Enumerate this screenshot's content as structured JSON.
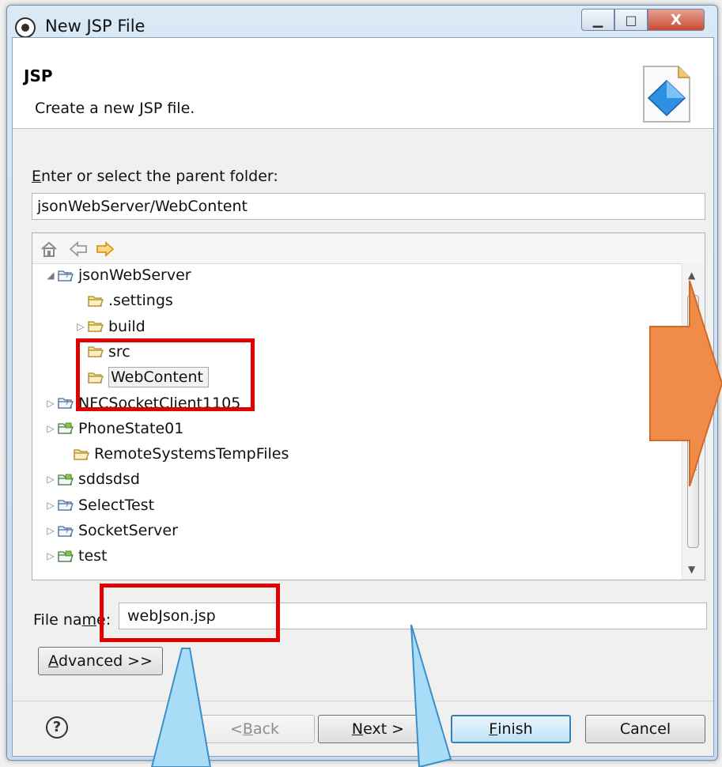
{
  "window": {
    "title": "New JSP File",
    "min_label": "▁",
    "max_label": "□",
    "close_label": "X"
  },
  "header": {
    "title": "JSP",
    "description": "Create a new JSP file."
  },
  "parent_folder": {
    "label_prefix": "",
    "label_mnemonic": "E",
    "label_rest": "nter or select the parent folder:",
    "value": "jsonWebServer/WebContent"
  },
  "tree": {
    "toolbar": [
      "home-icon",
      "back-icon",
      "forward-icon"
    ],
    "items": [
      {
        "label": "jsonWebServer",
        "twisty": "◢"
      },
      {
        "label": ".settings",
        "twisty": ""
      },
      {
        "label": "build",
        "twisty": "▷"
      },
      {
        "label": "src",
        "twisty": ""
      },
      {
        "label": "WebContent",
        "twisty": ""
      },
      {
        "label": "NFCSocketClient1105",
        "twisty": "▷"
      },
      {
        "label": "PhoneState01",
        "twisty": "▷"
      },
      {
        "label": "RemoteSystemsTempFiles",
        "twisty": ""
      },
      {
        "label": "sddsdsd",
        "twisty": "▷"
      },
      {
        "label": "SelectTest",
        "twisty": "▷"
      },
      {
        "label": "SocketServer",
        "twisty": "▷"
      },
      {
        "label": "test",
        "twisty": "▷"
      }
    ]
  },
  "file_name": {
    "label_prefix": "File na",
    "label_mnemonic": "m",
    "label_rest": "e:",
    "value": "webJson.jsp"
  },
  "buttons": {
    "advanced_mnemonic": "A",
    "advanced_rest": "dvanced >>",
    "help": "?",
    "back_prefix": "< ",
    "back_mnemonic": "B",
    "back_rest": "ack",
    "next_mnemonic": "N",
    "next_rest": "ext >",
    "finish_mnemonic": "F",
    "finish_rest": "inish",
    "cancel": "Cancel"
  },
  "colors": {
    "highlight": "#e00000",
    "arrow": "#f08b4a",
    "callout": "#a9dcf6"
  }
}
